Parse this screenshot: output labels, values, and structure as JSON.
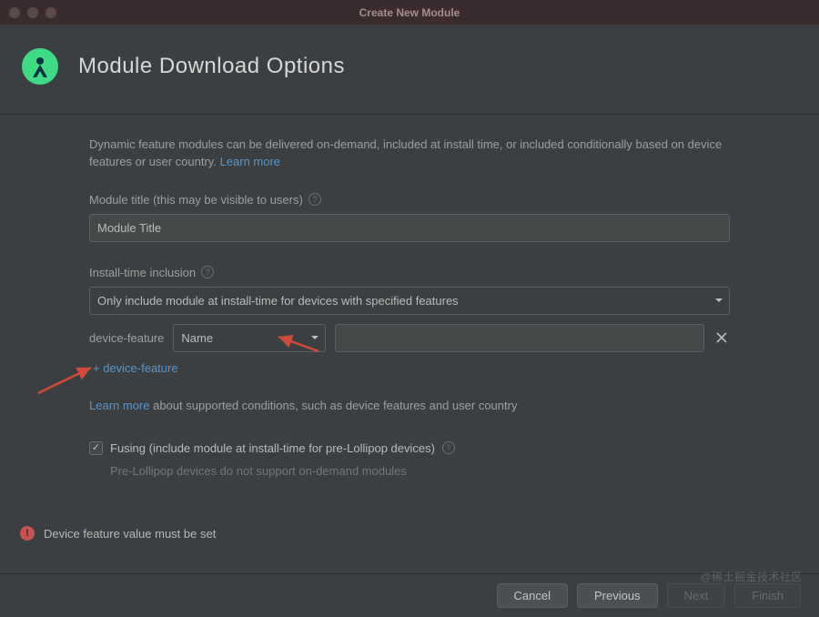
{
  "window": {
    "title": "Create New Module"
  },
  "header": {
    "title": "Module Download Options"
  },
  "description": {
    "text": "Dynamic feature modules can be delivered on-demand, included at install time, or included conditionally based on device features or user country.",
    "learn_more": "Learn more"
  },
  "module_title": {
    "label": "Module title (this may be visible to users)",
    "value": "Module Title"
  },
  "install_time": {
    "label": "Install-time inclusion",
    "selected": "Only include module at install-time for devices with specified features"
  },
  "device_feature": {
    "row_label": "device-feature",
    "name_selected": "Name",
    "value": "",
    "add_label": "+ device-feature"
  },
  "conditions_note": {
    "learn_more": "Learn more",
    "rest": " about supported conditions, such as device features and user country"
  },
  "fusing": {
    "label": "Fusing (include module at install-time for pre-Lollipop devices)",
    "checked": true,
    "note": "Pre-Lollipop devices do not support on-demand modules"
  },
  "error": {
    "message": "Device feature value must be set"
  },
  "footer": {
    "cancel": "Cancel",
    "previous": "Previous",
    "next": "Next",
    "finish": "Finish"
  },
  "watermark": "@稀土掘金技术社区"
}
